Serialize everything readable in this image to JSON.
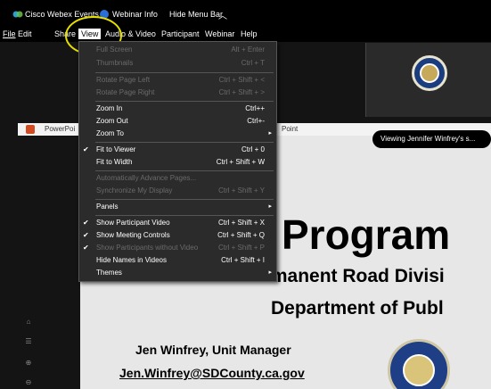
{
  "topbar": {
    "app_title": "Cisco Webex Events",
    "webinar_info": "Webinar Info",
    "hide_menu_bar": "Hide Menu Bar"
  },
  "menubar": {
    "items": [
      "File",
      "Edit",
      "Share",
      "View",
      "Audio & Video",
      "Participant",
      "Webinar",
      "Help"
    ]
  },
  "view_menu": {
    "rows": [
      {
        "label": "Full Screen",
        "shortcut": "Alt + Enter",
        "enabled": false,
        "checked": false
      },
      {
        "label": "Thumbnails",
        "shortcut": "Ctrl + T",
        "enabled": false,
        "checked": false
      },
      {
        "label": "Rotate Page Left",
        "shortcut": "Ctrl + Shift + <",
        "enabled": false,
        "checked": false
      },
      {
        "label": "Rotate Page Right",
        "shortcut": "Ctrl + Shift + >",
        "enabled": false,
        "checked": false
      },
      {
        "label": "Zoom In",
        "shortcut": "Ctrl++",
        "enabled": true,
        "checked": false
      },
      {
        "label": "Zoom Out",
        "shortcut": "Ctrl+-",
        "enabled": true,
        "checked": false
      },
      {
        "label": "Zoom To",
        "shortcut": "",
        "enabled": true,
        "checked": false,
        "submenu": true
      },
      {
        "label": "Fit to Viewer",
        "shortcut": "Ctrl + 0",
        "enabled": true,
        "checked": true
      },
      {
        "label": "Fit to Width",
        "shortcut": "Ctrl + Shift + W",
        "enabled": true,
        "checked": false
      },
      {
        "label": "Automatically Advance Pages...",
        "shortcut": "",
        "enabled": false,
        "checked": false
      },
      {
        "label": "Synchronize My Display",
        "shortcut": "Ctrl + Shift + Y",
        "enabled": false,
        "checked": false
      },
      {
        "label": "Panels",
        "shortcut": "",
        "enabled": true,
        "checked": false,
        "submenu": true
      },
      {
        "label": "Show Participant Video",
        "shortcut": "Ctrl + Shift + X",
        "enabled": true,
        "checked": true
      },
      {
        "label": "Show Meeting Controls",
        "shortcut": "Ctrl + Shift + Q",
        "enabled": true,
        "checked": true
      },
      {
        "label": "Show Participants without Video",
        "shortcut": "Ctrl + Shift + P",
        "enabled": false,
        "checked": true
      },
      {
        "label": "Hide Names in Videos",
        "shortcut": "Ctrl + Shift + I",
        "enabled": true,
        "checked": false
      },
      {
        "label": "Themes",
        "shortcut": "",
        "enabled": true,
        "checked": false,
        "submenu": true
      }
    ]
  },
  "ppt_strip": {
    "label": "PowerPoi",
    "suffix": "Point"
  },
  "viewing_tooltip": "Viewing Jennifer Winfrey's s...",
  "slide": {
    "title": "Program",
    "division": "Permanent Road Divisi",
    "department": "Department of Publ",
    "presenter": "Jen Winfrey, Unit Manager",
    "email": "Jen.Winfrey@SDCounty.ca.gov"
  },
  "colors": {
    "annotation": "#e6e000",
    "info_icon": "#2a6fd6",
    "ppt_icon": "#d04a22",
    "seal_blue": "#1e3f86"
  }
}
